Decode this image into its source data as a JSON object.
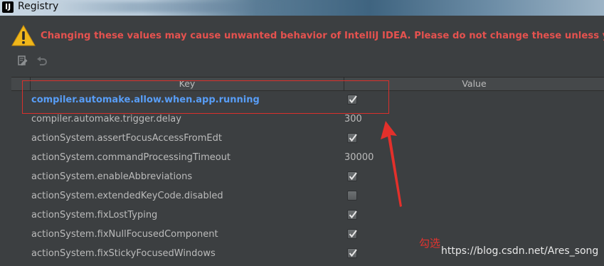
{
  "window": {
    "title": "Registry"
  },
  "warning": {
    "text": "Changing these values may cause unwanted behavior of IntelliJ IDEA. Please do not change these unless you have been asked."
  },
  "toolbar": {
    "edit_icon": "edit-icon",
    "revert_icon": "revert-icon"
  },
  "table": {
    "columns": [
      "Key",
      "Value"
    ],
    "rows": [
      {
        "key": "compiler.automake.allow.when.app.running",
        "type": "checkbox",
        "checked": true,
        "changed": true
      },
      {
        "key": "compiler.automake.trigger.delay",
        "type": "text",
        "value": "300"
      },
      {
        "key": "actionSystem.assertFocusAccessFromEdt",
        "type": "checkbox",
        "checked": true
      },
      {
        "key": "actionSystem.commandProcessingTimeout",
        "type": "text",
        "value": "30000"
      },
      {
        "key": "actionSystem.enableAbbreviations",
        "type": "checkbox",
        "checked": true
      },
      {
        "key": "actionSystem.extendedKeyCode.disabled",
        "type": "checkbox",
        "checked": false
      },
      {
        "key": "actionSystem.fixLostTyping",
        "type": "checkbox",
        "checked": true
      },
      {
        "key": "actionSystem.fixNullFocusedComponent",
        "type": "checkbox",
        "checked": true
      },
      {
        "key": "actionSystem.fixStickyFocusedWindows",
        "type": "checkbox",
        "checked": true
      }
    ]
  },
  "annotation": {
    "note": "勾选",
    "watermark": "https://blog.csdn.net/Ares_song"
  },
  "colors": {
    "background": "#3c3f41",
    "warning": "#e5524f",
    "changed_key": "#589df6",
    "annotation": "#d9302c"
  }
}
